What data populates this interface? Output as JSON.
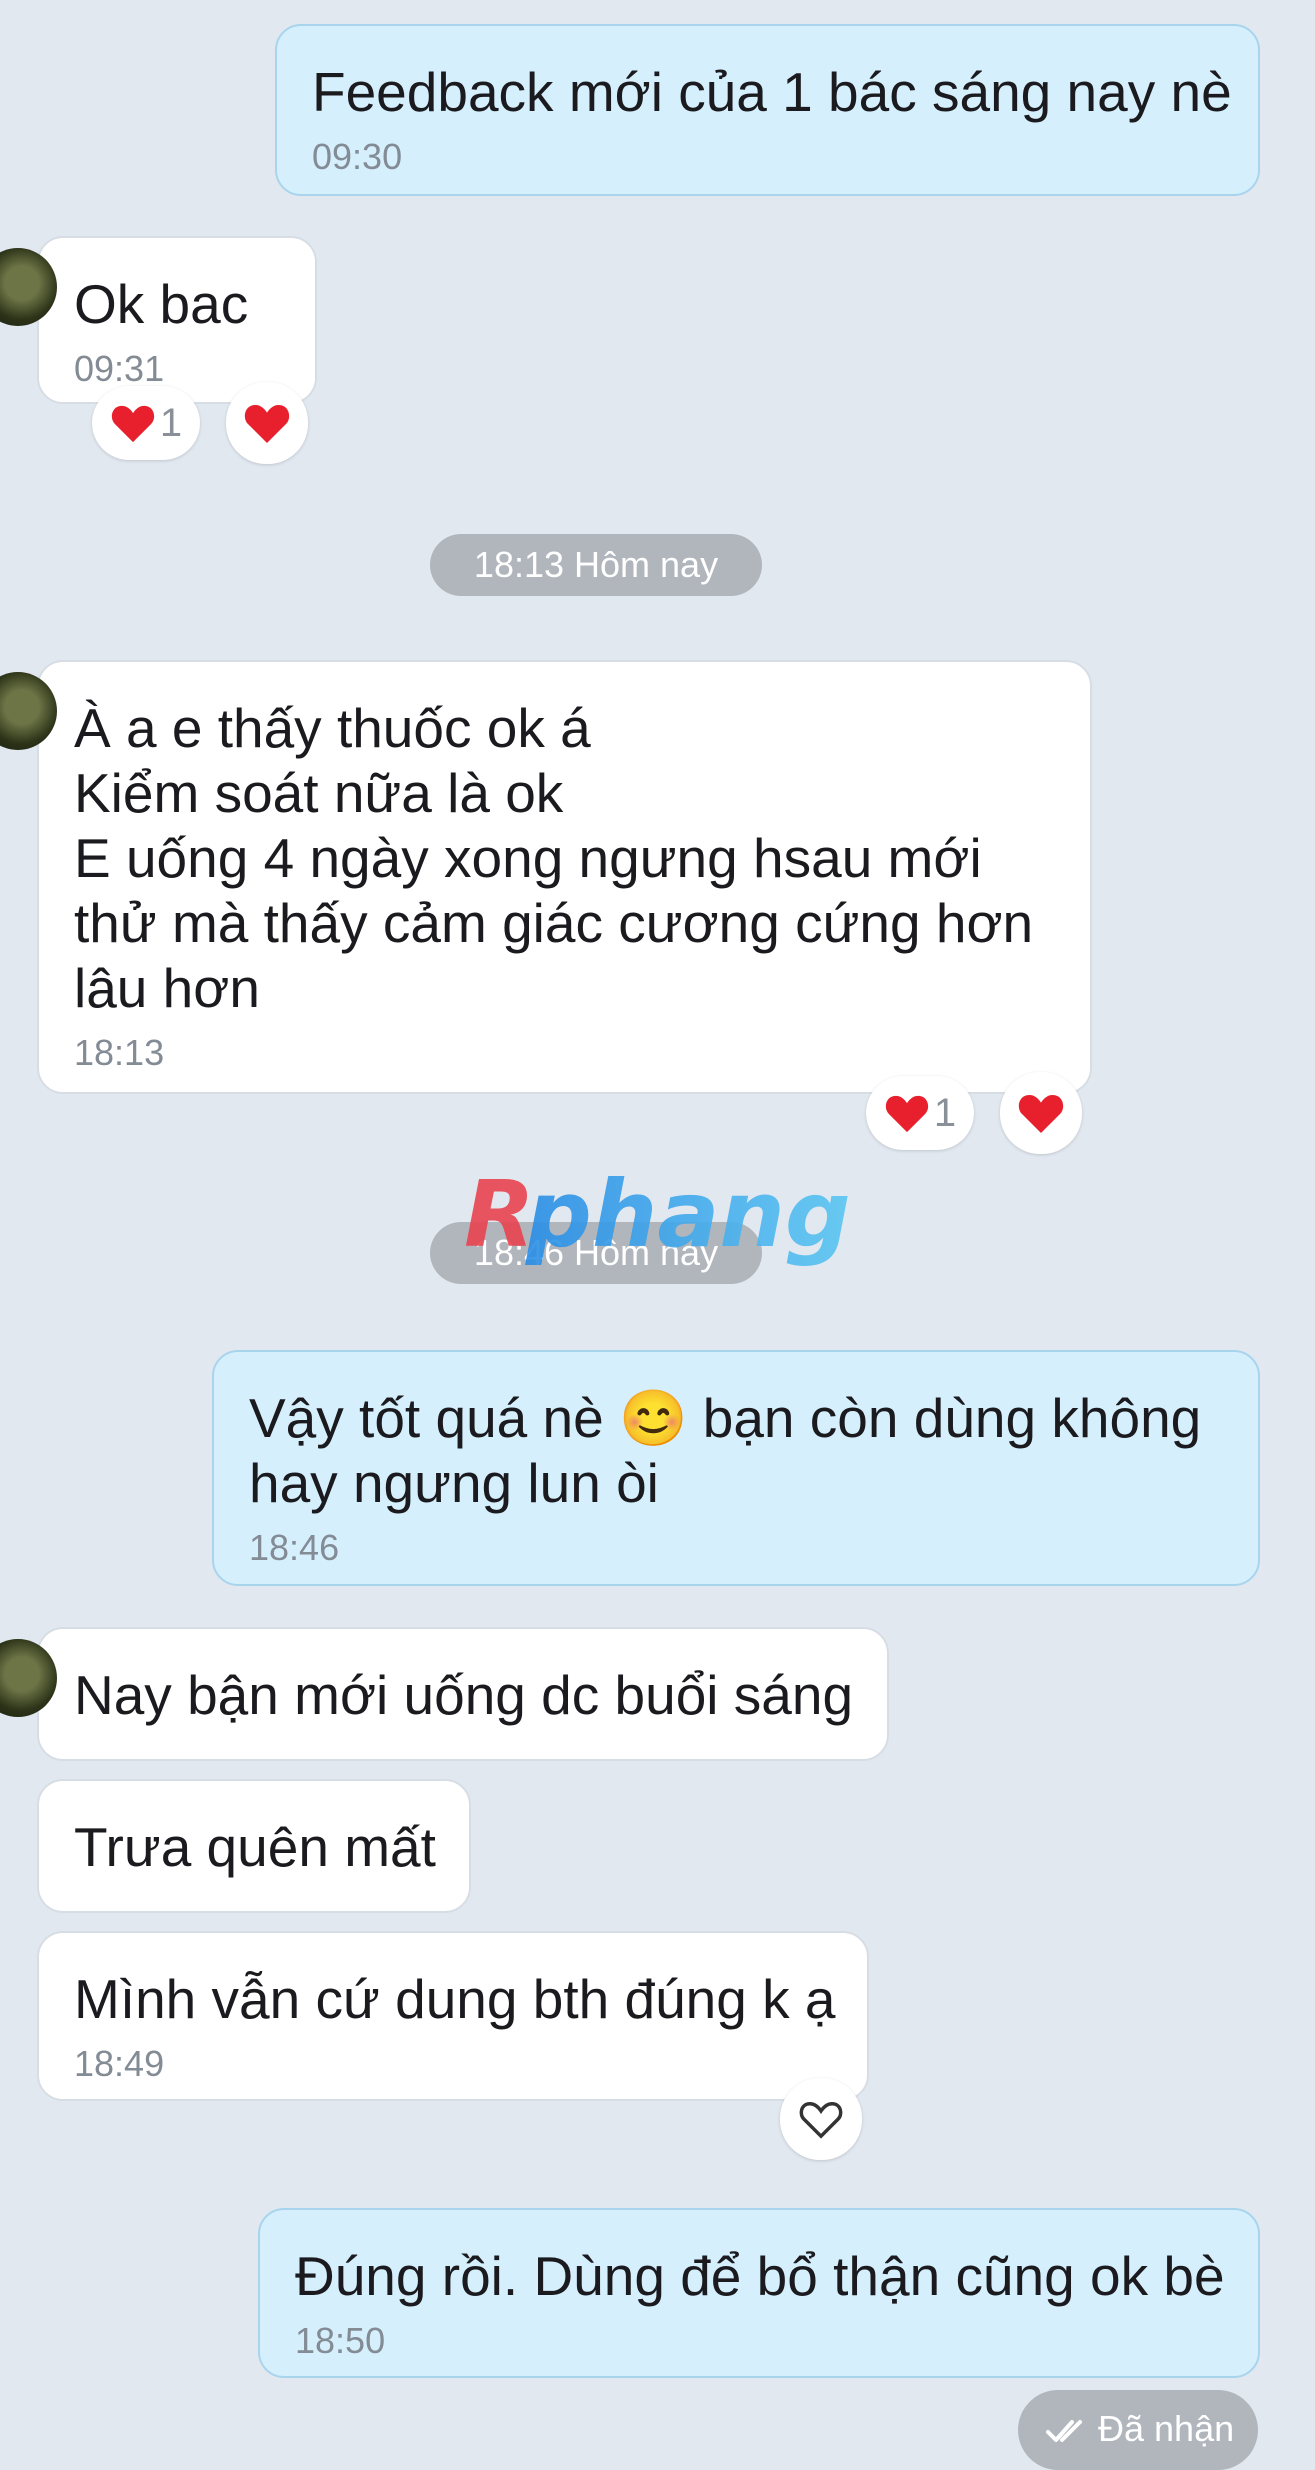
{
  "messages": [
    {
      "text": "Feedback mới của 1 bác sáng nay nè",
      "time": "09:30"
    },
    {
      "text": "Ok bac",
      "time": "09:31",
      "reaction_count": "1"
    },
    {
      "text": "À a e thấy thuốc ok á\nKiểm soát nữa là ok\nE uống 4 ngày xong ngưng hsau mới thử mà thấy cảm giác cương cứng hơn lâu hơn",
      "time": "18:13",
      "reaction_count": "1"
    },
    {
      "text": "Vậy tốt quá nè 😊  bạn còn dùng không hay ngưng lun òi",
      "time": "18:46"
    },
    {
      "text": "Nay bận mới uống dc buổi sáng"
    },
    {
      "text": "Trưa quên mất"
    },
    {
      "text": "Mình vẫn cứ dung bth đúng k ạ",
      "time": "18:49"
    },
    {
      "text": "Đúng rồi. Dùng để bổ thận cũng ok bè",
      "time": "18:50"
    }
  ],
  "separators": [
    "18:13 Hôm nay",
    "18:46 Hôm nay"
  ],
  "status": {
    "seen_label": "Đã nhận"
  },
  "watermark": {
    "text": "Rphang",
    "colors": [
      "#e8434f",
      "#2a8ee6",
      "#5bc6f2"
    ]
  },
  "colors": {
    "outgoing_bubble": "#d5effd",
    "incoming_bubble": "#ffffff",
    "background": "#e2e8f0",
    "heart": "#e8202e"
  }
}
